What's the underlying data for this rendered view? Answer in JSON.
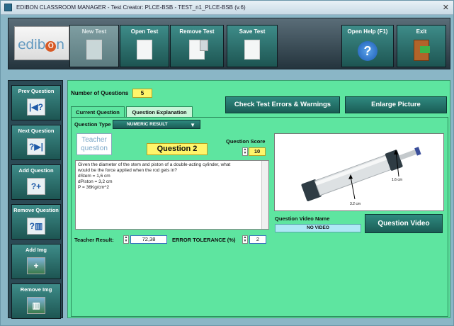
{
  "window": {
    "title": "EDIBON CLASSROOM MANAGER - Test Creator: PLCE-BSB - TEST_n1_PLCE-BSB (v.6)"
  },
  "brand": {
    "logo_text_left": "edib",
    "logo_text_dot": "o",
    "logo_text_right": "n"
  },
  "toolbar": {
    "new_test": "New Test",
    "open_test": "Open Test",
    "remove_test": "Remove Test",
    "save_test": "Save Test",
    "open_help": "Open Help (F1)",
    "exit": "Exit"
  },
  "sidebar": {
    "prev_question": "Prev Question",
    "next_question": "Next Question",
    "add_question": "Add Question",
    "remove_question": "Remove Question",
    "add_img": "Add Img",
    "remove_img": "Remove Img"
  },
  "main": {
    "num_questions_label": "Number of Questions",
    "num_questions_value": "5",
    "check_errors_button": "Check Test Errors & Warnings",
    "enlarge_picture_button": "Enlarge Picture",
    "tabs": [
      "Current Question",
      "Question Explanation"
    ],
    "question_type_label": "Question Type",
    "question_type_value": "NUMERIC RESULT",
    "teacher_question_label": "Teacher question",
    "question_number": "Question 2",
    "question_score_label": "Question Score",
    "question_score_value": "10",
    "question_text": [
      "Given the diameter of the stem and piston of a double-acting cylinder, what",
      "would be the force applied when the rod gets in?",
      "dStem = 1,6 cm",
      "dPiston = 3,2 cm",
      "P = 36Kg/cm^2"
    ],
    "teacher_result_label": "Teacher Result:",
    "teacher_result_value": "72,38",
    "error_tolerance_label": "ERROR TOLERANCE (%)",
    "error_tolerance_value": "2",
    "picture_labels": {
      "stem": "1.6 cm",
      "piston": "3.2 cm"
    },
    "question_video_name_label": "Question Video Name",
    "question_video_name_value": "NO VIDEO",
    "question_video_button": "Question Video"
  }
}
